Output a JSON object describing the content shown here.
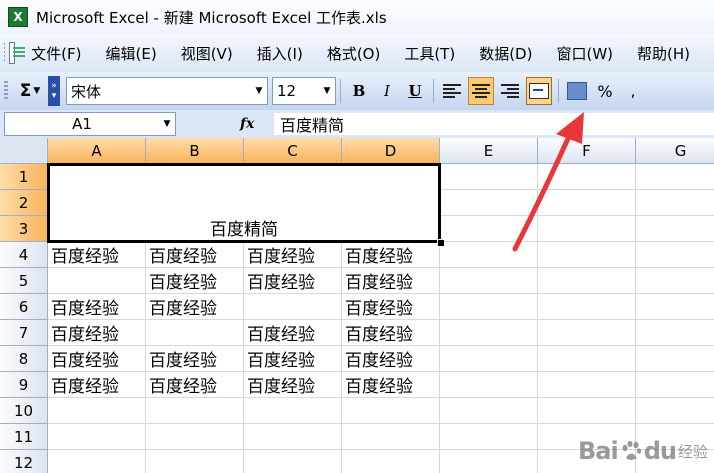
{
  "window": {
    "title": "Microsoft Excel - 新建 Microsoft Excel 工作表.xls"
  },
  "menu": [
    {
      "label": "文件(F)"
    },
    {
      "label": "编辑(E)"
    },
    {
      "label": "视图(V)"
    },
    {
      "label": "插入(I)"
    },
    {
      "label": "格式(O)"
    },
    {
      "label": "工具(T)"
    },
    {
      "label": "数据(D)"
    },
    {
      "label": "窗口(W)"
    },
    {
      "label": "帮助(H)"
    }
  ],
  "toolbar": {
    "autosum_symbol": "Σ",
    "font_name": "宋体",
    "font_size": "12",
    "bold_label": "B",
    "italic_label": "I",
    "underline_label": "U",
    "percent_label": "%",
    "comma_label": ",",
    "active_button": "align-center",
    "highlighted_button": "merge-and-center"
  },
  "formula_bar": {
    "name_box": "A1",
    "fx_label": "fx",
    "content": "百度精简"
  },
  "grid": {
    "columns": [
      "A",
      "B",
      "C",
      "D",
      "E",
      "F",
      "G"
    ],
    "selected_columns": [
      "A",
      "B",
      "C",
      "D"
    ],
    "rows": [
      "1",
      "2",
      "3",
      "4",
      "5",
      "6",
      "7",
      "8",
      "9",
      "10",
      "11",
      "12"
    ],
    "selected_rows": [
      "1",
      "2",
      "3"
    ],
    "merged_cell": {
      "range": "A1:D3",
      "text": "百度精简",
      "alignment": "bottom-center"
    },
    "cells": [
      [
        "百度经验",
        "百度经验",
        "百度经验",
        "百度经验"
      ],
      [
        "",
        "百度经验",
        "百度经验",
        "百度经验"
      ],
      [
        "百度经验",
        "百度经验",
        "",
        "百度经验"
      ],
      [
        "百度经验",
        "",
        "百度经验",
        "百度经验"
      ],
      [
        "百度经验",
        "百度经验",
        "百度经验",
        "百度经验"
      ],
      [
        "百度经验",
        "百度经验",
        "百度经验",
        "百度经验"
      ]
    ]
  },
  "annotation": {
    "color": "#e8373a",
    "points_to": "merge-and-center-button"
  },
  "watermark": {
    "brand": "Bai",
    "brand_suffix": "du",
    "sub": "经验",
    "url": "jingyan.baidu.com"
  }
}
